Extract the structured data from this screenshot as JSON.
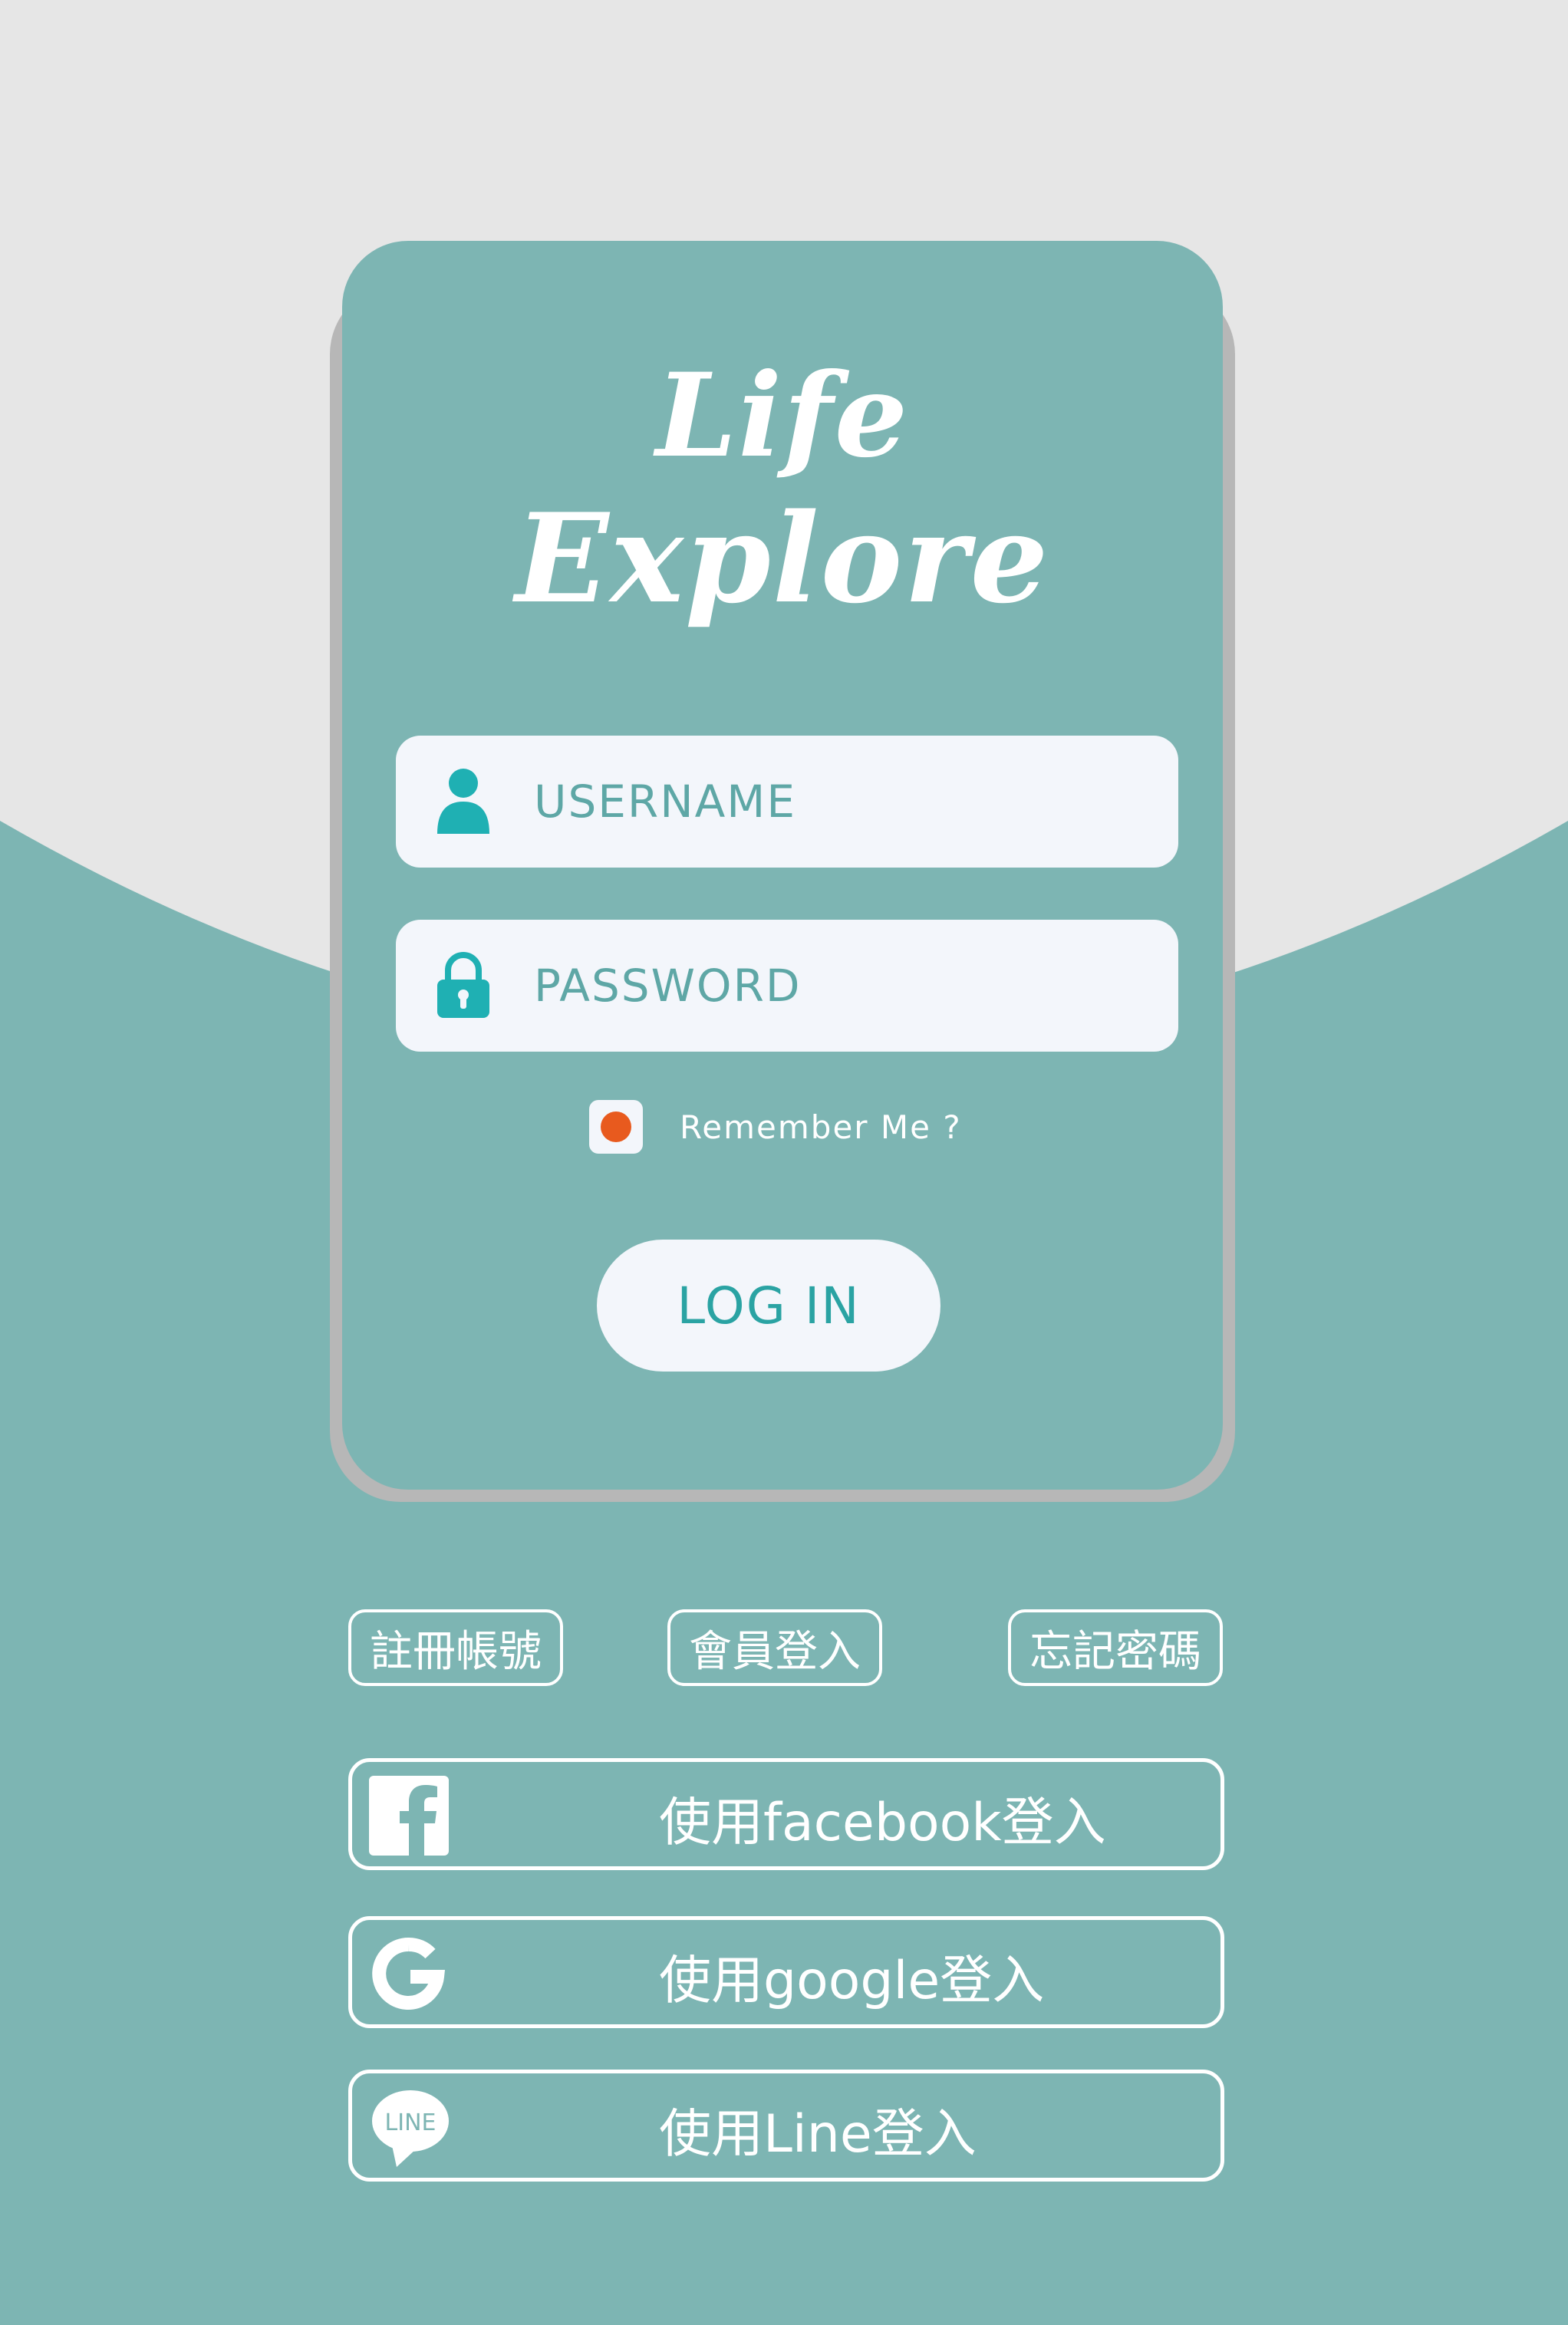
{
  "theme": {
    "background_top": "#e6e6e6",
    "background_main": "#7db5b3",
    "card": "#7db5b3",
    "card_shadow": "#b7b7b7",
    "field_bg": "#f3f6fb",
    "accent": "#2aa3a3",
    "remember_dot": "#e85a1e",
    "text_light": "#ffffff"
  },
  "logo": {
    "line1": "Life",
    "line2": "Explore"
  },
  "form": {
    "username": {
      "placeholder": "USERNAME",
      "value": "",
      "icon": "user-icon"
    },
    "password": {
      "placeholder": "PASSWORD",
      "value": "",
      "icon": "lock-icon"
    },
    "remember_label": "Remember Me ?",
    "remember_checked": true,
    "login_label": "LOG IN"
  },
  "links": {
    "register": "註冊帳號",
    "member_login": "會員登入",
    "forgot_password": "忘記密碼"
  },
  "social": {
    "facebook": {
      "label": "使用facebook登入",
      "icon": "facebook-icon"
    },
    "google": {
      "label": "使用google登入",
      "icon": "google-icon"
    },
    "line": {
      "label": "使用Line登入",
      "icon": "line-icon",
      "icon_text": "LINE"
    }
  }
}
